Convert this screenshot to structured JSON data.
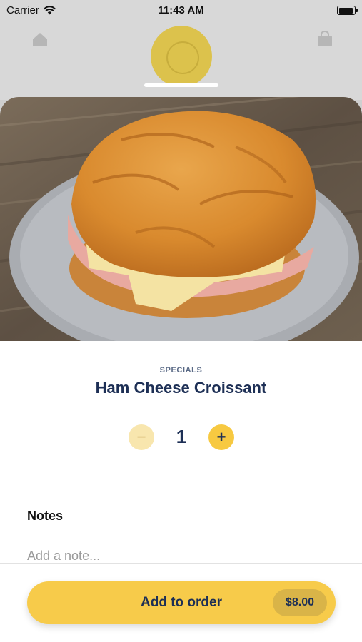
{
  "status_bar": {
    "carrier": "Carrier",
    "time": "11:43 AM",
    "battery_level": 0.95
  },
  "background": {
    "accent": "#f7cb4a"
  },
  "item": {
    "category": "SPECIALS",
    "name": "Ham Cheese Croissant",
    "photo_icon": "croissant-sandwich-photo"
  },
  "quantity": {
    "value": "1",
    "minus_icon": "minus-icon",
    "plus_icon": "plus-icon"
  },
  "notes": {
    "label": "Notes",
    "placeholder": "Add a note..."
  },
  "order_button": {
    "label": "Add to order",
    "price": "$8.00"
  },
  "colors": {
    "navy": "#1d2f55",
    "yellow": "#f7cb4a",
    "price_pill": "#d9b448"
  }
}
